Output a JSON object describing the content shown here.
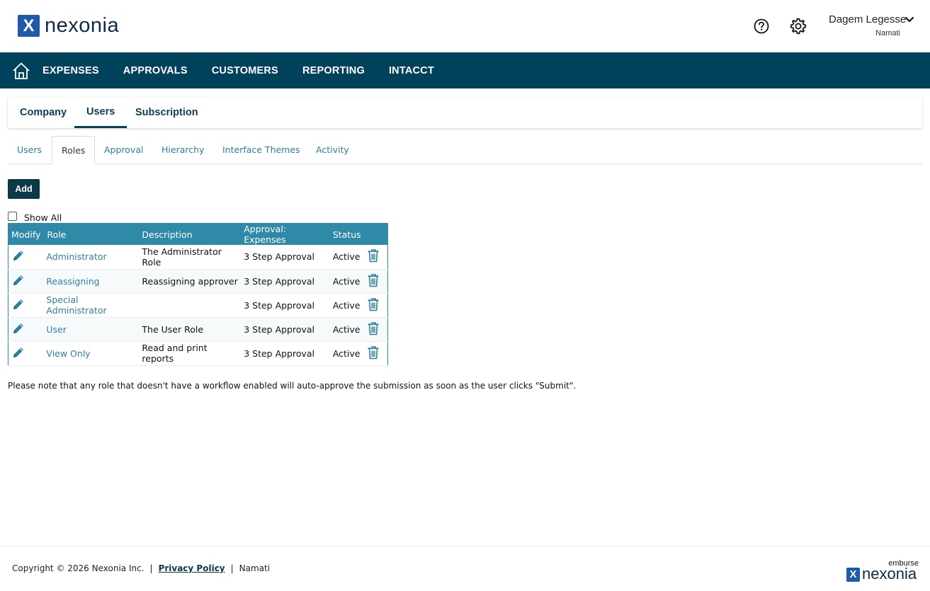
{
  "header": {
    "logo_text": "nexonia",
    "user_name": "Dagem Legesse",
    "user_org": "Namati",
    "icons": [
      "help-icon",
      "gear-icon",
      "chevron-down-icon"
    ]
  },
  "mainnav": {
    "items": [
      "EXPENSES",
      "APPROVALS",
      "CUSTOMERS",
      "REPORTING",
      "INTACCT"
    ]
  },
  "toptabs": [
    {
      "label": "Company",
      "active": false
    },
    {
      "label": "Users",
      "active": true
    },
    {
      "label": "Subscription",
      "active": false
    }
  ],
  "subtabs": [
    {
      "label": "Users",
      "active": false
    },
    {
      "label": "Roles",
      "active": true
    },
    {
      "label": "Approval",
      "active": false
    },
    {
      "label": "Hierarchy",
      "active": false
    },
    {
      "label": "Interface Themes",
      "active": false
    },
    {
      "label": "Activity",
      "active": false
    }
  ],
  "add_label": "Add",
  "show_all_label": "Show All",
  "table": {
    "columns": [
      "Modify",
      "Role",
      "Description",
      "Approval: Expenses",
      "Status"
    ],
    "rows": [
      {
        "role": "Administrator",
        "description": "The Administrator Role",
        "approval": "3 Step Approval",
        "status": "Active"
      },
      {
        "role": "Reassigning",
        "description": "Reassigning approver",
        "approval": "3 Step Approval",
        "status": "Active"
      },
      {
        "role": "Special Administrator",
        "description": "",
        "approval": "3 Step Approval",
        "status": "Active"
      },
      {
        "role": "User",
        "description": "The User Role",
        "approval": "3 Step Approval",
        "status": "Active"
      },
      {
        "role": "View Only",
        "description": "Read and print reports",
        "approval": "3 Step Approval",
        "status": "Active"
      }
    ]
  },
  "note": "Please note that any role that doesn't have a workflow enabled will auto-approve the submission as soon as the user clicks \"Submit\".",
  "footer": {
    "copyright": "Copyright © 2026 Nexonia Inc.",
    "privacy": "Privacy Policy",
    "org": "Namati",
    "brand_top": "emburse",
    "brand_bottom": "nexonia"
  },
  "colors": {
    "nav_bg": "#00415c",
    "table_header": "#2e8aa6",
    "link": "#2e7f9a",
    "button": "#0d3848",
    "logo_blue": "#1f5aa8"
  }
}
